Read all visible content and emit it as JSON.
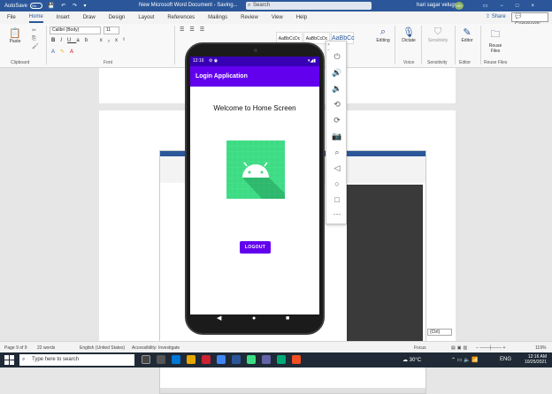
{
  "word": {
    "title_bar": {
      "autosave_label": "AutoSave",
      "autosave_state": "On",
      "document_title": "New Microsoft Word Document - Saving...",
      "search_placeholder": "Search",
      "user_name": "hari sagar velugula",
      "user_initials": "HS"
    },
    "menu_tabs": [
      "File",
      "Home",
      "Insert",
      "Draw",
      "Design",
      "Layout",
      "References",
      "Mailings",
      "Review",
      "View",
      "Help"
    ],
    "active_tab": "Home",
    "share_label": "Share",
    "comments_label": "Comments",
    "ribbon": {
      "paste_label": "Paste",
      "font_name": "Calibri (Body)",
      "font_size": "11",
      "styles": [
        "AaBbCcDc",
        "AaBbCcDc",
        "AaBbCc"
      ],
      "editing_label": "Editing",
      "dictate_label": "Dictate",
      "sensitivity_label": "Sensitivity",
      "editor_label": "Editor",
      "reuse_files_label": "Reuse Files",
      "groups": {
        "clipboard": "Clipboard",
        "font": "Font",
        "voice": "Voice",
        "sensitivity": "Sensitivity",
        "editor": "Editor",
        "reuse_files": "Reuse Files"
      }
    },
    "paste_options_label": "(Ctrl)",
    "status_bar": {
      "page": "Page 9 of 9",
      "words": "22 words",
      "language": "English (United States)",
      "accessibility": "Accessibility: Investigate",
      "focus": "Focus",
      "zoom": "119%"
    }
  },
  "emulator": {
    "toolbar_icons": [
      "power-icon",
      "volume-up-icon",
      "volume-down-icon",
      "rotate-left-icon",
      "rotate-right-icon",
      "camera-icon",
      "zoom-icon",
      "back-icon",
      "home-icon",
      "overview-icon",
      "more-icon"
    ],
    "controls": [
      "×",
      "−"
    ]
  },
  "phone": {
    "status_time": "12:16",
    "app_title": "Login Application",
    "welcome_text": "Welcome to Home Screen",
    "logout_label": "LOGOUT",
    "colors": {
      "status_bar": "#3700b3",
      "app_bar": "#6200ee",
      "logo_background": "#3ddc84",
      "button": "#6200ee"
    }
  },
  "taskbar": {
    "search_placeholder": "Type here to search",
    "temperature": "30°C",
    "language": "ENG",
    "time": "12:16 AM",
    "date": "10/25/2021"
  }
}
